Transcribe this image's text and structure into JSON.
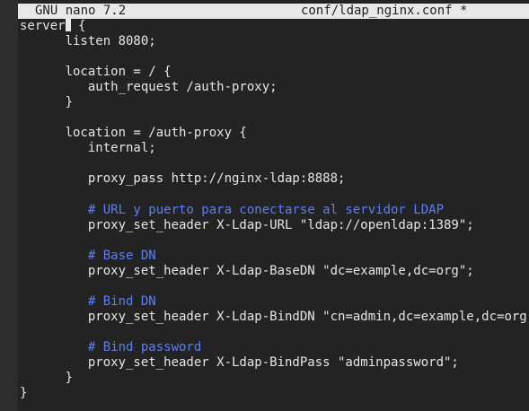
{
  "titlebar": {
    "app": "GNU nano 7.2",
    "filename": "conf/ldap_nginx.conf *"
  },
  "editor": {
    "lines": [
      {
        "text": "server {",
        "kind": "code"
      },
      {
        "text": "      listen 8080;",
        "kind": "code"
      },
      {
        "text": "",
        "kind": "code"
      },
      {
        "text": "      location = / {",
        "kind": "code"
      },
      {
        "text": "         auth_request /auth-proxy;",
        "kind": "code"
      },
      {
        "text": "      }",
        "kind": "code"
      },
      {
        "text": "",
        "kind": "code"
      },
      {
        "text": "      location = /auth-proxy {",
        "kind": "code"
      },
      {
        "text": "         internal;",
        "kind": "code"
      },
      {
        "text": "",
        "kind": "code"
      },
      {
        "text": "         proxy_pass http://nginx-ldap:8888;",
        "kind": "code"
      },
      {
        "text": "",
        "kind": "code"
      },
      {
        "text": "         # URL y puerto para conectarse al servidor LDAP",
        "kind": "comment"
      },
      {
        "text": "         proxy_set_header X-Ldap-URL \"ldap://openldap:1389\";",
        "kind": "code"
      },
      {
        "text": "",
        "kind": "code"
      },
      {
        "text": "         # Base DN",
        "kind": "comment"
      },
      {
        "text": "         proxy_set_header X-Ldap-BaseDN \"dc=example,dc=org\";",
        "kind": "code"
      },
      {
        "text": "",
        "kind": "code"
      },
      {
        "text": "         # Bind DN",
        "kind": "comment"
      },
      {
        "text": "         proxy_set_header X-Ldap-BindDN \"cn=admin,dc=example,dc=org\";",
        "kind": "code"
      },
      {
        "text": "",
        "kind": "code"
      },
      {
        "text": "         # Bind password",
        "kind": "comment"
      },
      {
        "text": "         proxy_set_header X-Ldap-BindPass \"adminpassword\";",
        "kind": "code"
      },
      {
        "text": "      }",
        "kind": "code"
      },
      {
        "text": "}",
        "kind": "code"
      }
    ]
  }
}
